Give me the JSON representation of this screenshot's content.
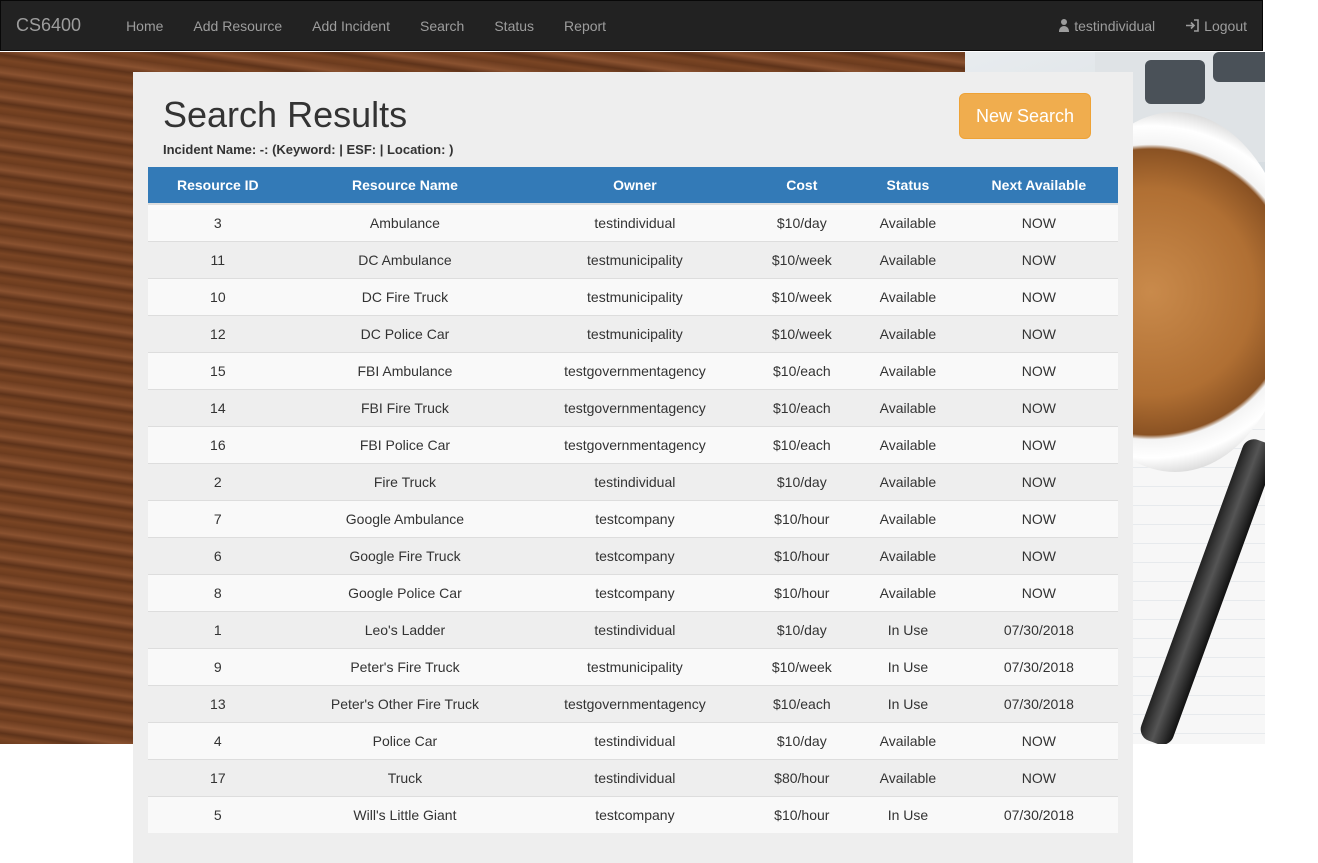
{
  "navbar": {
    "brand": "CS6400",
    "links": [
      "Home",
      "Add Resource",
      "Add Incident",
      "Search",
      "Status",
      "Report"
    ],
    "user": "testindividual",
    "logout": "Logout"
  },
  "page": {
    "title": "Search Results",
    "subtitle": "Incident Name: -: (Keyword: | ESF: | Location: )",
    "new_search_label": "New Search"
  },
  "table": {
    "headers": [
      "Resource ID",
      "Resource Name",
      "Owner",
      "Cost",
      "Status",
      "Next Available"
    ],
    "rows": [
      [
        "3",
        "Ambulance",
        "testindividual",
        "$10/day",
        "Available",
        "NOW"
      ],
      [
        "11",
        "DC Ambulance",
        "testmunicipality",
        "$10/week",
        "Available",
        "NOW"
      ],
      [
        "10",
        "DC Fire Truck",
        "testmunicipality",
        "$10/week",
        "Available",
        "NOW"
      ],
      [
        "12",
        "DC Police Car",
        "testmunicipality",
        "$10/week",
        "Available",
        "NOW"
      ],
      [
        "15",
        "FBI Ambulance",
        "testgovernmentagency",
        "$10/each",
        "Available",
        "NOW"
      ],
      [
        "14",
        "FBI Fire Truck",
        "testgovernmentagency",
        "$10/each",
        "Available",
        "NOW"
      ],
      [
        "16",
        "FBI Police Car",
        "testgovernmentagency",
        "$10/each",
        "Available",
        "NOW"
      ],
      [
        "2",
        "Fire Truck",
        "testindividual",
        "$10/day",
        "Available",
        "NOW"
      ],
      [
        "7",
        "Google Ambulance",
        "testcompany",
        "$10/hour",
        "Available",
        "NOW"
      ],
      [
        "6",
        "Google Fire Truck",
        "testcompany",
        "$10/hour",
        "Available",
        "NOW"
      ],
      [
        "8",
        "Google Police Car",
        "testcompany",
        "$10/hour",
        "Available",
        "NOW"
      ],
      [
        "1",
        "Leo's Ladder",
        "testindividual",
        "$10/day",
        "In Use",
        "07/30/2018"
      ],
      [
        "9",
        "Peter's Fire Truck",
        "testmunicipality",
        "$10/week",
        "In Use",
        "07/30/2018"
      ],
      [
        "13",
        "Peter's Other Fire Truck",
        "testgovernmentagency",
        "$10/each",
        "In Use",
        "07/30/2018"
      ],
      [
        "4",
        "Police Car",
        "testindividual",
        "$10/day",
        "Available",
        "NOW"
      ],
      [
        "17",
        "Truck",
        "testindividual",
        "$80/hour",
        "Available",
        "NOW"
      ],
      [
        "5",
        "Will's Little Giant",
        "testcompany",
        "$10/hour",
        "In Use",
        "07/30/2018"
      ]
    ]
  },
  "colors": {
    "navbar_bg": "#222222",
    "header_bg": "#337ab7",
    "new_search_bg": "#f0ad4e"
  }
}
